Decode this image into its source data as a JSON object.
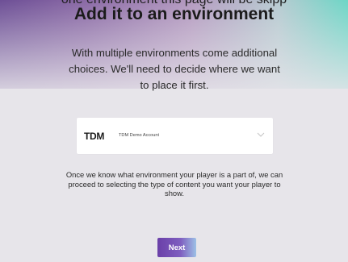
{
  "header": {
    "cut_text": "one environment this page will be skipp",
    "title": "Add it to an environment"
  },
  "intro_text": "With multiple environments come additional choices. We'll need to decide where we want to place it first.",
  "environment_select": {
    "logo_text": "TDM",
    "selected_value": "TDM Demo Account",
    "chevron_icon": "chevron-down-icon"
  },
  "explain_text": "Once we know what environment your player is a part of, we can proceed to selecting the type of content you want your player to show.",
  "next_button": {
    "label": "Next"
  },
  "colors": {
    "gradient_left": "#6d4f96",
    "gradient_right": "#6dd6c6",
    "button_start": "#6a3fa8",
    "button_end": "#9dc0e6",
    "background": "#e7e5ea"
  }
}
